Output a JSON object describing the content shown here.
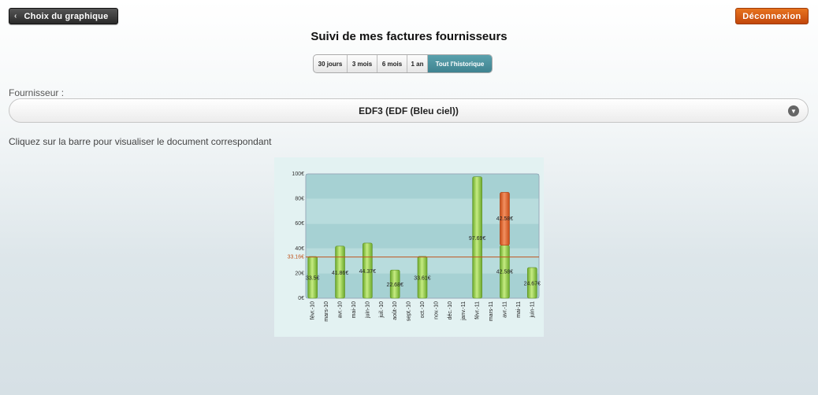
{
  "header": {
    "back_label": "Choix du graphique",
    "logout_label": "Déconnexion"
  },
  "page": {
    "title": "Suivi de mes factures fournisseurs",
    "periods": [
      "30 jours",
      "3 mois",
      "6 mois",
      "1 an",
      "Tout l'historique"
    ],
    "active_period": "Tout l'historique",
    "supplier_label": "Fournisseur :",
    "supplier_value": "EDF3 (EDF (Bleu ciel))",
    "hint": "Cliquez sur la barre pour visualiser le document correspondant"
  },
  "colors": {
    "bar_green": "#8cc63f",
    "bar_orange": "#e0662a",
    "average_line": "#c0551f",
    "plot_band_dark": "#a6d1d3",
    "plot_band_light": "#b8dcdd",
    "accent_teal": "#4a8f9b"
  },
  "chart_data": {
    "type": "bar",
    "categories": [
      "févr.-10",
      "mars-10",
      "avr.-10",
      "mai-10",
      "juin-10",
      "juil.-10",
      "août-10",
      "sept.-10",
      "oct.-10",
      "nov.-10",
      "déc.-10",
      "janv.-11",
      "févr.-11",
      "mars-11",
      "avr.-11",
      "mai-11",
      "juin-11"
    ],
    "series": [
      {
        "values": [
          33.5,
          null,
          41.86,
          null,
          44.37,
          null,
          22.68,
          null,
          33.61,
          null,
          null,
          null,
          97.69,
          null,
          42.58,
          null,
          24.67
        ]
      },
      {
        "values": [
          null,
          null,
          null,
          null,
          null,
          null,
          null,
          null,
          null,
          null,
          null,
          null,
          null,
          null,
          42.58,
          null,
          null
        ]
      }
    ],
    "value_labels": [
      "33.5€",
      "",
      "41.86€",
      "",
      "44.37€",
      "",
      "22.68€",
      "",
      "33.61€",
      "",
      "",
      "",
      "97.69€",
      "",
      "42.58€",
      "",
      "24.67€"
    ],
    "stack_label": "42.58€",
    "y_ticks": [
      0,
      20,
      40,
      60,
      80,
      100
    ],
    "y_tick_labels": [
      "0€",
      "20€",
      "40€",
      "60€",
      "80€",
      "100€"
    ],
    "ylim": [
      0,
      100
    ],
    "average": 33.16,
    "average_label": "33.16€"
  }
}
